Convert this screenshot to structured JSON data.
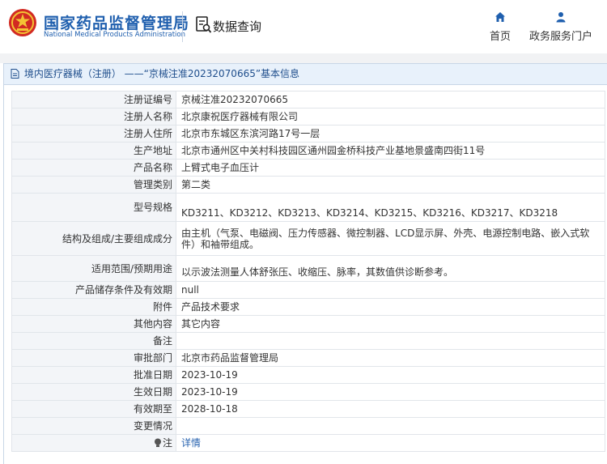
{
  "header": {
    "site_name": "国家药品监督管理局",
    "site_name_en": "National Medical Products Administration",
    "search_label": "数据查询",
    "nav": [
      {
        "label": "首页",
        "icon": "home-icon"
      },
      {
        "label": "政务服务门户",
        "icon": "user-icon"
      }
    ]
  },
  "panel": {
    "title": "境内医疗器械（注册） ——“京械注准20232070665”基本信息"
  },
  "rows": [
    {
      "key": "注册证编号",
      "value": "京械注准20232070665"
    },
    {
      "key": "注册人名称",
      "value": "北京康祝医疗器械有限公司"
    },
    {
      "key": "注册人住所",
      "value": "北京市东城区东滨河路17号一层"
    },
    {
      "key": "生产地址",
      "value": "北京市通州区中关村科技园区通州园金桥科技产业基地景盛南四街11号"
    },
    {
      "key": "产品名称",
      "value": "上臂式电子血压计"
    },
    {
      "key": "管理类别",
      "value": "第二类"
    },
    {
      "key": "型号规格",
      "value": "KD3211、KD3212、KD3213、KD3214、KD3215、KD3216、KD3217、KD3218"
    },
    {
      "key": "结构及组成/主要组成成分",
      "value": "由主机（气泵、电磁阀、压力传感器、微控制器、LCD显示屏、外壳、电源控制电路、嵌入式软件）和袖带组成。"
    },
    {
      "key": "适用范围/预期用途",
      "value": "以示波法测量人体舒张压、收缩压、脉率，其数值供诊断参考。"
    },
    {
      "key": "产品储存条件及有效期",
      "value": "null"
    },
    {
      "key": "附件",
      "value": "产品技术要求"
    },
    {
      "key": "其他内容",
      "value": "其它内容"
    },
    {
      "key": "备注",
      "value": ""
    },
    {
      "key": "审批部门",
      "value": "北京市药品监督管理局"
    },
    {
      "key": "批准日期",
      "value": "2023-10-19"
    },
    {
      "key": "生效日期",
      "value": "2023-10-19"
    },
    {
      "key": "有效期至",
      "value": "2028-10-18"
    },
    {
      "key": "变更情况",
      "value": ""
    },
    {
      "key": "注",
      "value": "详情"
    }
  ],
  "colors": {
    "brand_blue": "#1f5fae",
    "emblem_red": "#d22a22",
    "link_blue": "#2a64b0"
  }
}
